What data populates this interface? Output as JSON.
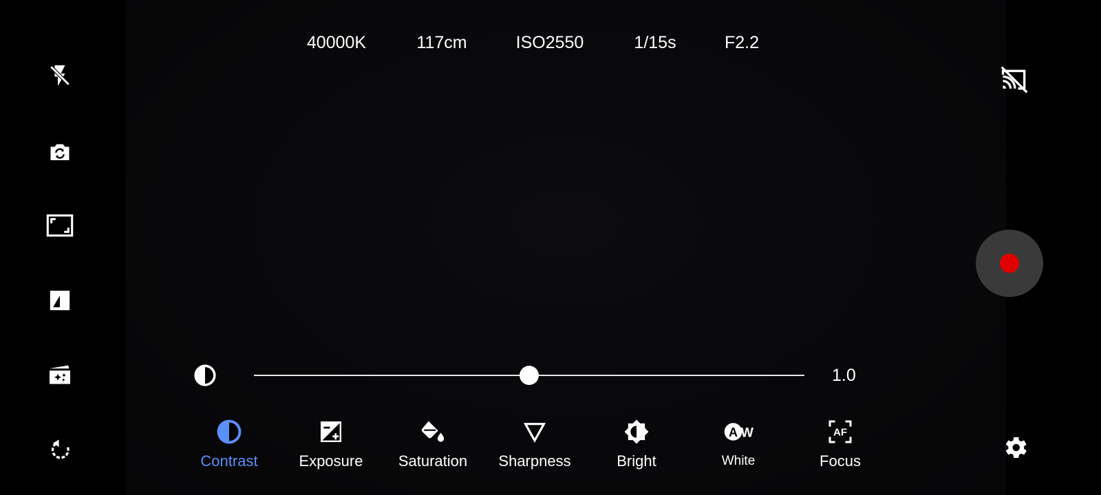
{
  "status_bar": {
    "white_balance": "40000K",
    "focus_distance": "117cm",
    "iso": "ISO2550",
    "shutter": "1/15s",
    "aperture": "F2.2"
  },
  "left_toolbar": {
    "items": [
      {
        "icon": "flash-off-icon"
      },
      {
        "icon": "switch-camera-icon"
      },
      {
        "icon": "aspect-ratio-icon"
      },
      {
        "icon": "filter-icon"
      },
      {
        "icon": "video-effects-icon"
      },
      {
        "icon": "rotate-icon"
      }
    ]
  },
  "right_toolbar": {
    "cast_icon": "cast-off-icon",
    "record_color": "#e00000",
    "settings_icon": "gear-icon"
  },
  "slider": {
    "icon": "contrast-icon",
    "value_text": "1.0",
    "position_fraction": 0.5
  },
  "tools": [
    {
      "label": "Contrast",
      "icon": "contrast-icon",
      "active": true
    },
    {
      "label": "Exposure",
      "icon": "exposure-icon",
      "active": false
    },
    {
      "label": "Saturation",
      "icon": "saturation-icon",
      "active": false
    },
    {
      "label": "Sharpness",
      "icon": "sharpness-icon",
      "active": false
    },
    {
      "label": "Bright",
      "icon": "brightness-icon",
      "active": false
    },
    {
      "label": "White",
      "icon": "white-balance-auto-icon",
      "icon_text": "AW",
      "active": false
    },
    {
      "label": "Focus",
      "icon": "autofocus-icon",
      "icon_text": "AF",
      "active": false
    }
  ],
  "colors": {
    "accent": "#5b8ff9",
    "record": "#e00000",
    "record_ring": "#3a3a3a"
  }
}
